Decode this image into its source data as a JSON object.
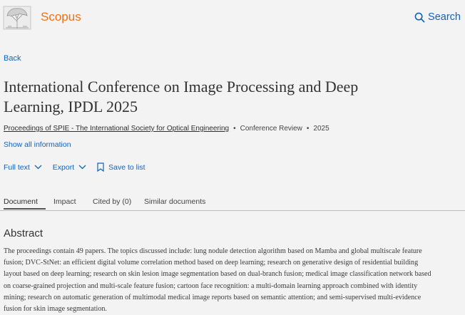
{
  "header": {
    "brand": "Scopus",
    "search_label": "Search",
    "accent_color": "#e9711c",
    "link_color": "#0b64c0"
  },
  "nav": {
    "back_label": "Back"
  },
  "document": {
    "title": "International Conference on Image Processing and Deep Learning, IPDL 2025",
    "source_title": "Proceedings of SPIE - The International Society for Optical Engineering",
    "doc_type": "Conference Review",
    "year": "2025",
    "show_all_label": "Show all information"
  },
  "actions": {
    "full_text_label": "Full text",
    "export_label": "Export",
    "save_label": "Save to list"
  },
  "tabs": [
    {
      "label": "Document",
      "active": true
    },
    {
      "label": "Impact",
      "active": false
    },
    {
      "label": "Cited by (0)",
      "active": false
    },
    {
      "label": "Similar documents",
      "active": false
    }
  ],
  "abstract": {
    "heading": "Abstract",
    "text": "The proceedings contain 49 papers. The topics discussed include: lung nodule detection algorithm based on Mamba and global multiscale feature fusion; DVC-StNet: an efficient digital volume correlation method based on deep learning; research on generative design of residential building layout based on deep learning; research on skin lesion image segmentation based on dual-branch fusion; medical image classification network based on coarse-grained projection and multi-scale feature fusion; cartoon face recognition: a multi-domain learning approach combined with identity mining; research on automatic generation of multimodal medical image reports based on semantic attention; and semi-supervised multi-evidence fusion for skin image segmentation."
  }
}
